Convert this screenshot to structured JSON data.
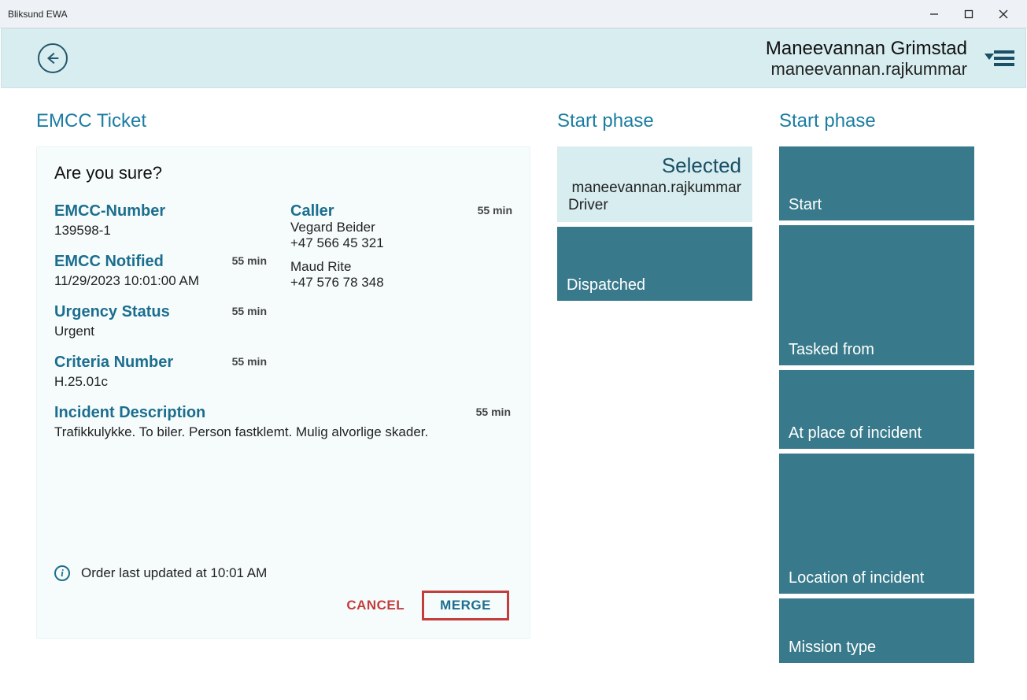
{
  "window": {
    "title": "Bliksund EWA"
  },
  "header": {
    "user_name": "Maneevannan Grimstad",
    "user_id": "maneevannan.rajkummar"
  },
  "left": {
    "section_title": "EMCC Ticket",
    "confirm_title": "Are you sure?",
    "fields": {
      "emcc_number": {
        "label": "EMCC-Number",
        "value": "139598-1"
      },
      "emcc_notified": {
        "label": "EMCC Notified",
        "value": "11/29/2023 10:01:00 AM",
        "time": "55 min"
      },
      "urgency": {
        "label": "Urgency Status",
        "value": "Urgent",
        "time": "55 min"
      },
      "criteria": {
        "label": "Criteria Number",
        "value": "H.25.01c",
        "time": "55 min"
      },
      "caller": {
        "label": "Caller",
        "lines": [
          "Vegard Beider",
          "+47 566 45 321",
          "Maud Rite",
          "+47 576 78 348"
        ],
        "time": "55 min"
      },
      "incident": {
        "label": "Incident Description",
        "value": "Trafikkulykke. To biler. Person fastklemt. Mulig alvorlige skader.",
        "time": "55 min"
      }
    },
    "footer_text": "Order last updated at 10:01 AM",
    "buttons": {
      "cancel": "CANCEL",
      "merge": "MERGE"
    }
  },
  "mid": {
    "title": "Start phase",
    "selected": {
      "title": "Selected",
      "line1": "maneevannan.rajkummar",
      "line2": "Driver"
    },
    "tiles": [
      {
        "label": "Dispatched"
      }
    ]
  },
  "right": {
    "title": "Start phase",
    "tiles": [
      {
        "label": "Start"
      },
      {
        "label": "Tasked from"
      },
      {
        "label": "At place of incident"
      },
      {
        "label": "Location of incident"
      },
      {
        "label": "Mission type"
      }
    ]
  }
}
